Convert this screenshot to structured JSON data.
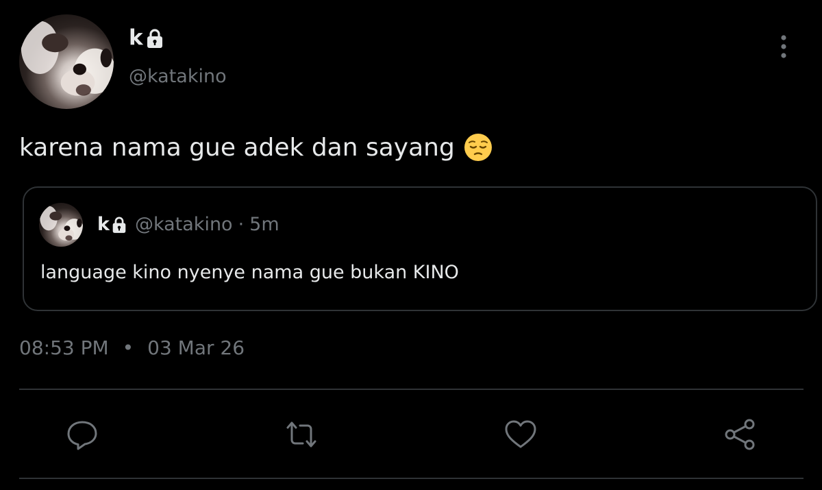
{
  "author": {
    "display_name": "k",
    "handle": "@katakino",
    "avatar_icon": "dog-photo-avatar",
    "protected_icon": "lock-icon"
  },
  "tweet": {
    "text": "karena nama gue adek dan sayang",
    "emoji": "pensive-face-emoji",
    "time": "08:53 PM",
    "separator": "•",
    "date": "03 Mar 26"
  },
  "quoted_tweet": {
    "display_name": "k",
    "handle": "@katakino",
    "separator": "·",
    "time": "5m",
    "text": "language kino nyenye nama gue bukan KINO"
  },
  "actions": [
    {
      "name": "reply",
      "icon": "reply-icon"
    },
    {
      "name": "retweet",
      "icon": "retweet-icon"
    },
    {
      "name": "like",
      "icon": "heart-icon"
    },
    {
      "name": "share",
      "icon": "share-icon"
    }
  ],
  "colors": {
    "background": "#000000",
    "primary_text": "#e7e9ea",
    "secondary_text": "#71767b",
    "border": "#2f3336"
  }
}
